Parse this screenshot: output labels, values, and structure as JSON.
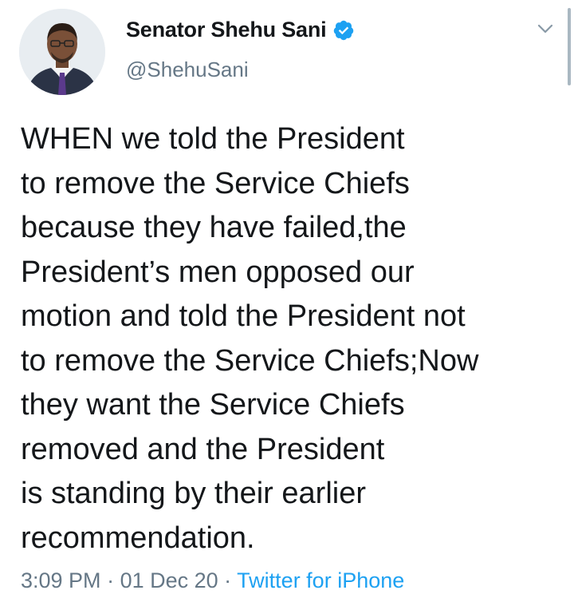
{
  "author": {
    "display_name": "Senator Shehu Sani",
    "handle": "@ShehuSani",
    "verified": true,
    "verified_icon": "verified-badge-icon",
    "verified_color": "#1da1f2"
  },
  "tweet": {
    "lines": [
      "WHEN we told the President",
      "to remove the Service Chiefs",
      "because they have failed,the",
      "President’s men opposed our",
      "motion and told the President not",
      "to remove the Service Chiefs;Now",
      "they want the Service Chiefs",
      "removed and the President",
      "is standing by their earlier",
      "recommendation."
    ],
    "time": "3:09 PM",
    "separator1": " · ",
    "date": "01 Dec 20",
    "separator2": " · ",
    "source": "Twitter for iPhone"
  },
  "colors": {
    "text": "#14171a",
    "muted": "#657786",
    "link": "#1da1f2"
  },
  "icons": {
    "menu": "chevron-down-icon"
  }
}
